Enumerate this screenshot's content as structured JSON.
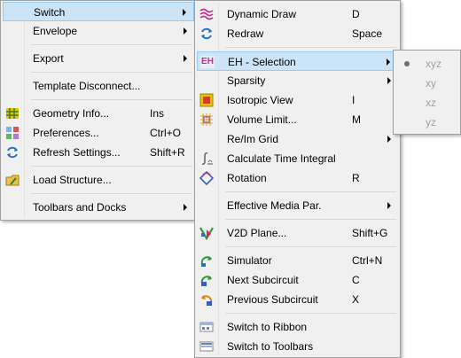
{
  "menu_main": {
    "switch": "Switch",
    "envelope": "Envelope",
    "export": "Export",
    "template_disconnect": "Template Disconnect...",
    "geometry_info": "Geometry Info...",
    "geometry_info_sc": "Ins",
    "preferences": "Preferences...",
    "preferences_sc": "Ctrl+O",
    "refresh_settings": "Refresh Settings...",
    "refresh_settings_sc": "Shift+R",
    "load_structure": "Load Structure...",
    "toolbars_docks": "Toolbars and Docks"
  },
  "menu_switch": {
    "dynamic_draw": "Dynamic Draw",
    "dynamic_draw_sc": "D",
    "redraw": "Redraw",
    "redraw_sc": "Space",
    "eh_selection": "EH - Selection",
    "eh_icon_text": "EH",
    "sparsity": "Sparsity",
    "isotropic_view": "Isotropic View",
    "isotropic_view_sc": "I",
    "volume_limit": "Volume Limit...",
    "volume_limit_sc": "M",
    "reim_grid": "Re/Im Grid",
    "calc_time_integral": "Calculate Time Integral",
    "rotation": "Rotation",
    "rotation_sc": "R",
    "effective_media": "Effective Media Par.",
    "v2d_plane": "V2D Plane...",
    "v2d_plane_sc": "Shift+G",
    "simulator": "Simulator",
    "simulator_sc": "Ctrl+N",
    "next_subcircuit": "Next Subcircuit",
    "next_subcircuit_sc": "C",
    "previous_subcircuit": "Previous Subcircuit",
    "previous_subcircuit_sc": "X",
    "switch_ribbon": "Switch to Ribbon",
    "switch_toolbars": "Switch to Toolbars"
  },
  "menu_eh": {
    "xyz": "xyz",
    "xy": "xy",
    "xz": "xz",
    "yz": "yz"
  },
  "colors": {
    "menu_bg": "#f0f0f0",
    "highlight": "#cce4f7",
    "highlight_border": "#99c9ef",
    "disabled_text": "#a0a0a0"
  }
}
